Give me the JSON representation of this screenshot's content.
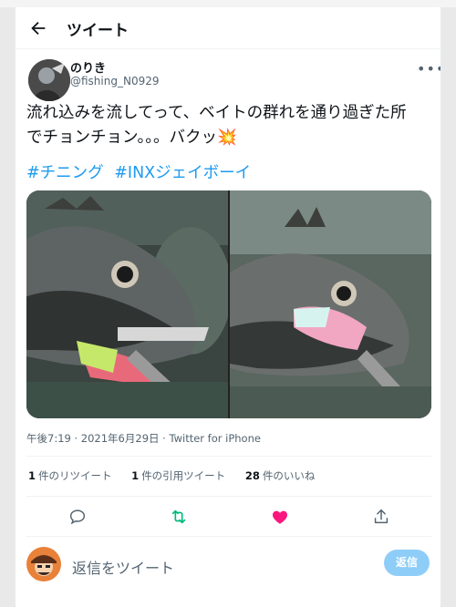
{
  "header": {
    "title": "ツイート"
  },
  "tweet": {
    "author_name": "のりき",
    "author_handle": "@fishing_N0929",
    "text_line1": "流れ込みを流してって、ベイトの群れを通り過ぎた所",
    "text_line2": "でチョンチョン。。。バクッ💥",
    "hashtags": [
      "#チニング",
      "#INXジェイボーイ"
    ],
    "meta": "午後7:19 · 2021年6月29日 · Twitter for iPhone"
  },
  "stats": {
    "retweets_count": "1",
    "retweets_label": "件のリツイート",
    "quotes_count": "1",
    "quotes_label": "件の引用ツイート",
    "likes_count": "28",
    "likes_label": "件のいいね"
  },
  "reply": {
    "placeholder": "返信をツイート",
    "button": "返信"
  },
  "colors": {
    "accent": "#1d9bf0",
    "retweet": "#00ba7c",
    "like": "#f91880"
  },
  "icons": [
    "back-arrow-icon",
    "more-icon",
    "reply-icon",
    "retweet-icon",
    "like-icon",
    "share-icon"
  ]
}
